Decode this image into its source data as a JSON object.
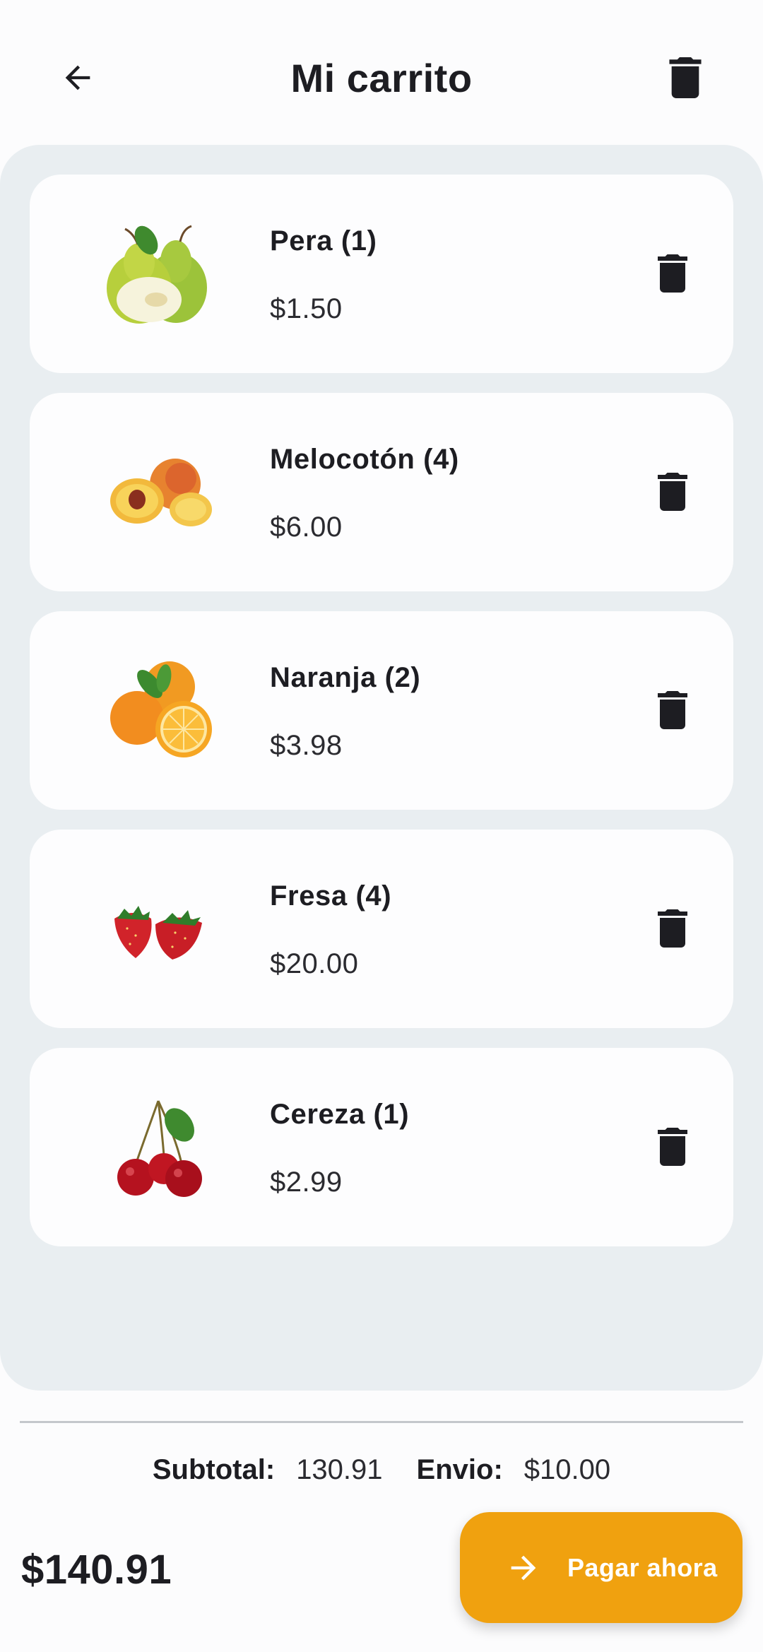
{
  "header": {
    "title": "Mi carrito",
    "back_icon": "arrow-left-icon",
    "clear_icon": "trash-icon"
  },
  "cart": {
    "items": [
      {
        "name": "Pera (1)",
        "price": "$1.50",
        "image": "pear-image"
      },
      {
        "name": "Melocotón (4)",
        "price": "$6.00",
        "image": "peach-image"
      },
      {
        "name": "Naranja (2)",
        "price": "$3.98",
        "image": "orange-image"
      },
      {
        "name": "Fresa (4)",
        "price": "$20.00",
        "image": "strawberry-image"
      },
      {
        "name": "Cereza (1)",
        "price": "$2.99",
        "image": "cherry-image"
      }
    ]
  },
  "summary": {
    "subtotal_label": "Subtotal:",
    "subtotal_value": "130.91",
    "shipping_label": "Envio:",
    "shipping_value": "$10.00",
    "total": "$140.91"
  },
  "pay_button": {
    "label": "Pagar ahora",
    "icon": "arrow-right-icon"
  },
  "colors": {
    "accent": "#f0a10f",
    "panel_bg": "#e9eef1",
    "card_bg": "#fdfdfe",
    "text": "#1d1d22"
  }
}
